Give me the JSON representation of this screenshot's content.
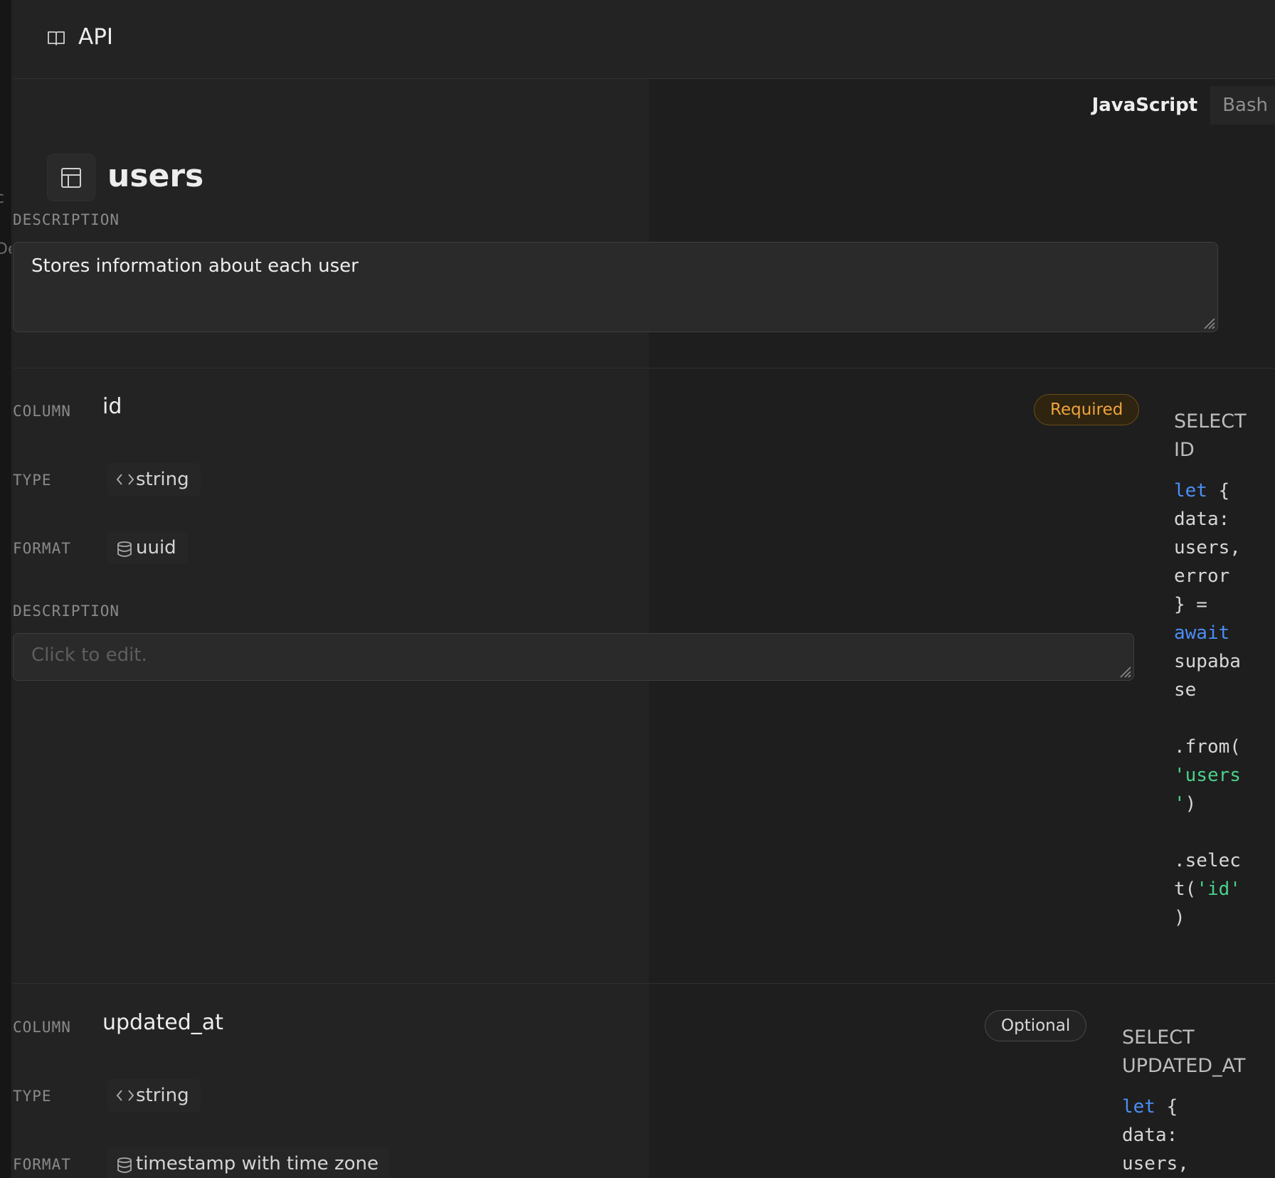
{
  "left_strip": {
    "fragments": [
      "c",
      "De"
    ]
  },
  "header": {
    "title": "API",
    "icon": "book-open-icon"
  },
  "lang_tabs": [
    {
      "label": "JavaScript",
      "active": true
    },
    {
      "label": "Bash",
      "active": false
    }
  ],
  "table": {
    "name": "users",
    "icon": "table-icon",
    "description_label": "DESCRIPTION",
    "description": "Stores information about each user"
  },
  "columns": [
    {
      "column_label": "COLUMN",
      "name": "id",
      "badge": "Required",
      "type_label": "TYPE",
      "type": "string",
      "format_label": "FORMAT",
      "format": "uuid",
      "description_label": "DESCRIPTION",
      "description_placeholder": "Click to edit.",
      "code_title": [
        "SELECT",
        "ID"
      ],
      "code": {
        "let": "let",
        "brace": " {",
        "l2": "data:",
        "l3": "users,",
        "l4": "error",
        "l5": "} =",
        "await": "await",
        "l7": "supaba",
        "l8": "se",
        "l9": ".from(",
        "l10": "'users",
        "l11a": "'",
        "l11b": ")",
        "l12": ".selec",
        "l13a": "t(",
        "l13b": "'id'",
        "l14": ")"
      }
    },
    {
      "column_label": "COLUMN",
      "name": "updated_at",
      "badge": "Optional",
      "type_label": "TYPE",
      "type": "string",
      "format_label": "FORMAT",
      "format": "timestamp with time zone",
      "code_title": [
        "SELECT",
        "UPDATED_AT"
      ],
      "code": {
        "let": "let",
        "brace": " {",
        "l2": "data:",
        "l3": "users,"
      }
    }
  ],
  "colors": {
    "bg": "#232323",
    "accent_blue": "#4b8ef5",
    "accent_green": "#4cd08a",
    "required": "#f1a43c"
  }
}
